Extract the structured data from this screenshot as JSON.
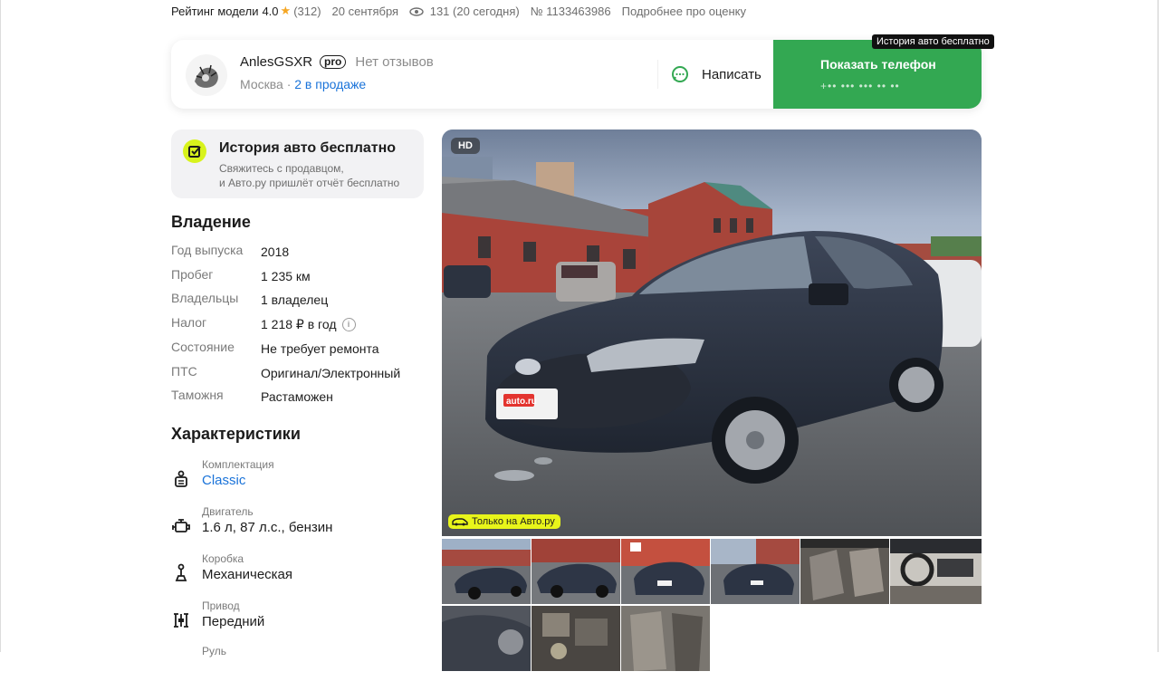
{
  "meta": {
    "rating_label": "Рейтинг модели",
    "rating_value": "4.0",
    "rating_count": "(312)",
    "date": "20 сентября",
    "views": "131 (20 сегодня)",
    "listing_id": "№ 1133463986",
    "rating_link": "Подробнее про оценку"
  },
  "seller": {
    "name": "AnlesGSXR",
    "pro_badge": "pro",
    "reviews": "Нет отзывов",
    "city": "Москва",
    "dot": "·",
    "in_sale": "2 в продаже",
    "write_label": "Написать",
    "phone_label": "Показать телефон",
    "phone_masked": "+•• ••• ••• •• ••",
    "tooltip": "История авто бесплатно"
  },
  "history": {
    "title": "История авто бесплатно",
    "subtitle_1": "Свяжитесь с продавцом,",
    "subtitle_2": "и Авто.ру пришлёт отчёт бесплатно"
  },
  "ownership": {
    "title": "Владение",
    "rows": [
      {
        "k": "Год выпуска",
        "v": "2018"
      },
      {
        "k": "Пробег",
        "v": "1 235 км"
      },
      {
        "k": "Владельцы",
        "v": "1 владелец"
      },
      {
        "k": "Налог",
        "v": "1 218 ₽ в год"
      },
      {
        "k": "Состояние",
        "v": "Не требует ремонта"
      },
      {
        "k": "ПТС",
        "v": "Оригинал/Электронный"
      },
      {
        "k": "Таможня",
        "v": "Растаможен"
      }
    ]
  },
  "specs": {
    "title": "Характеристики",
    "items": [
      {
        "k": "Комплектация",
        "v": "Classic",
        "icon": "trim-icon"
      },
      {
        "k": "Двигатель",
        "v": "1.6 л, 87 л.с., бензин",
        "icon": "engine-icon"
      },
      {
        "k": "Коробка",
        "v": "Механическая",
        "icon": "gearbox-icon"
      },
      {
        "k": "Привод",
        "v": "Передний",
        "icon": "drive-icon"
      },
      {
        "k": "Руль",
        "v": ""
      }
    ]
  },
  "photo": {
    "hd": "HD",
    "only_badge": "Только на Авто.ру",
    "plate": "auto.ru",
    "info_i": "i"
  },
  "colors": {
    "green": "#33a852",
    "link": "#1a73d9",
    "accent_yellow": "#e8f51a",
    "star": "#f5a623"
  }
}
